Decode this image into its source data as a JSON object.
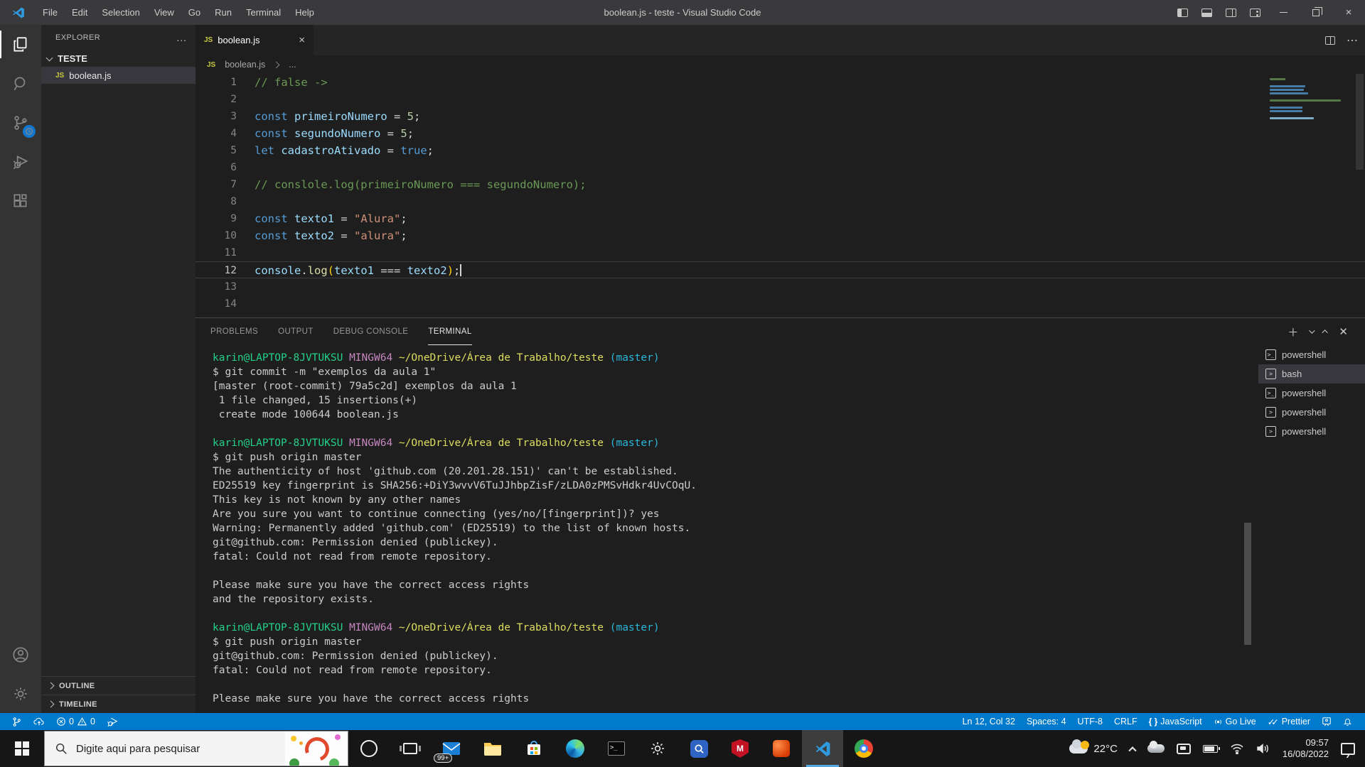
{
  "window": {
    "title": "boolean.js - teste - Visual Studio Code"
  },
  "menu_bar": {
    "items": [
      "File",
      "Edit",
      "Selection",
      "View",
      "Go",
      "Run",
      "Terminal",
      "Help"
    ]
  },
  "sidebar": {
    "header": "EXPLORER",
    "more": "...",
    "section": "TESTE",
    "files": [
      {
        "name": "boolean.js",
        "selected": true
      }
    ],
    "outline": "OUTLINE",
    "timeline": "TIMELINE"
  },
  "editor": {
    "tab": {
      "label": "boolean.js",
      "close": "×"
    },
    "breadcrumb": {
      "file": "boolean.js",
      "more": "..."
    },
    "cursor": {
      "line": 12,
      "col": 32
    },
    "lines": [
      {
        "n": 1,
        "tokens": [
          [
            "cmt",
            "// false ->"
          ]
        ]
      },
      {
        "n": 2,
        "tokens": []
      },
      {
        "n": 3,
        "tokens": [
          [
            "kw",
            "const"
          ],
          [
            "pl",
            " "
          ],
          [
            "var",
            "primeiroNumero"
          ],
          [
            "op",
            " = "
          ],
          [
            "num",
            "5"
          ],
          [
            "pl",
            ";"
          ]
        ]
      },
      {
        "n": 4,
        "tokens": [
          [
            "kw",
            "const"
          ],
          [
            "pl",
            " "
          ],
          [
            "var",
            "segundoNumero"
          ],
          [
            "op",
            " = "
          ],
          [
            "num",
            "5"
          ],
          [
            "pl",
            ";"
          ]
        ]
      },
      {
        "n": 5,
        "tokens": [
          [
            "kw",
            "let"
          ],
          [
            "pl",
            " "
          ],
          [
            "var",
            "cadastroAtivado"
          ],
          [
            "op",
            " = "
          ],
          [
            "kw",
            "true"
          ],
          [
            "pl",
            ";"
          ]
        ]
      },
      {
        "n": 6,
        "tokens": []
      },
      {
        "n": 7,
        "tokens": [
          [
            "cmt",
            "// conslole.log(primeiroNumero === segundoNumero);"
          ]
        ]
      },
      {
        "n": 8,
        "tokens": []
      },
      {
        "n": 9,
        "tokens": [
          [
            "kw",
            "const"
          ],
          [
            "pl",
            " "
          ],
          [
            "var",
            "texto1"
          ],
          [
            "op",
            " = "
          ],
          [
            "str",
            "\"Alura\""
          ],
          [
            "pl",
            ";"
          ]
        ]
      },
      {
        "n": 10,
        "tokens": [
          [
            "kw",
            "const"
          ],
          [
            "pl",
            " "
          ],
          [
            "var",
            "texto2"
          ],
          [
            "op",
            " = "
          ],
          [
            "str",
            "\"alura\""
          ],
          [
            "pl",
            ";"
          ]
        ]
      },
      {
        "n": 11,
        "tokens": []
      },
      {
        "n": 12,
        "current": true,
        "tokens": [
          [
            "var",
            "console"
          ],
          [
            "pl",
            "."
          ],
          [
            "fn",
            "log"
          ],
          [
            "par",
            "("
          ],
          [
            "var",
            "texto1"
          ],
          [
            "op",
            " === "
          ],
          [
            "var",
            "texto2"
          ],
          [
            "par",
            ")"
          ],
          [
            "pl",
            ";"
          ]
        ]
      },
      {
        "n": 13,
        "tokens": []
      },
      {
        "n": 14,
        "tokens": []
      }
    ]
  },
  "panel": {
    "tabs": [
      {
        "label": "PROBLEMS"
      },
      {
        "label": "OUTPUT"
      },
      {
        "label": "DEBUG CONSOLE"
      },
      {
        "label": "TERMINAL",
        "active": true
      }
    ],
    "terminal_lines": [
      [
        [
          "g",
          "karin@LAPTOP-8JVTUKSU"
        ],
        [
          "d",
          " "
        ],
        [
          "m",
          "MINGW64"
        ],
        [
          "d",
          " "
        ],
        [
          "y",
          "~/OneDrive/Área de Trabalho/teste"
        ],
        [
          "d",
          " "
        ],
        [
          "c",
          "(master)"
        ]
      ],
      [
        [
          "d",
          "$ git commit -m \"exemplos da aula 1\""
        ]
      ],
      [
        [
          "d",
          "[master (root-commit) 79a5c2d] exemplos da aula 1"
        ]
      ],
      [
        [
          "d",
          " 1 file changed, 15 insertions(+)"
        ]
      ],
      [
        [
          "d",
          " create mode 100644 boolean.js"
        ]
      ],
      [],
      [
        [
          "g",
          "karin@LAPTOP-8JVTUKSU"
        ],
        [
          "d",
          " "
        ],
        [
          "m",
          "MINGW64"
        ],
        [
          "d",
          " "
        ],
        [
          "y",
          "~/OneDrive/Área de Trabalho/teste"
        ],
        [
          "d",
          " "
        ],
        [
          "c",
          "(master)"
        ]
      ],
      [
        [
          "d",
          "$ git push origin master"
        ]
      ],
      [
        [
          "d",
          "The authenticity of host 'github.com (20.201.28.151)' can't be established."
        ]
      ],
      [
        [
          "d",
          "ED25519 key fingerprint is SHA256:+DiY3wvvV6TuJJhbpZisF/zLDA0zPMSvHdkr4UvCOqU."
        ]
      ],
      [
        [
          "d",
          "This key is not known by any other names"
        ]
      ],
      [
        [
          "d",
          "Are you sure you want to continue connecting (yes/no/[fingerprint])? yes"
        ]
      ],
      [
        [
          "d",
          "Warning: Permanently added 'github.com' (ED25519) to the list of known hosts."
        ]
      ],
      [
        [
          "d",
          "git@github.com: Permission denied (publickey)."
        ]
      ],
      [
        [
          "d",
          "fatal: Could not read from remote repository."
        ]
      ],
      [],
      [
        [
          "d",
          "Please make sure you have the correct access rights"
        ]
      ],
      [
        [
          "d",
          "and the repository exists."
        ]
      ],
      [],
      [
        [
          "g",
          "karin@LAPTOP-8JVTUKSU"
        ],
        [
          "d",
          " "
        ],
        [
          "m",
          "MINGW64"
        ],
        [
          "d",
          " "
        ],
        [
          "y",
          "~/OneDrive/Área de Trabalho/teste"
        ],
        [
          "d",
          " "
        ],
        [
          "c",
          "(master)"
        ]
      ],
      [
        [
          "d",
          "$ git push origin master"
        ]
      ],
      [
        [
          "d",
          "git@github.com: Permission denied (publickey)."
        ]
      ],
      [
        [
          "d",
          "fatal: Could not read from remote repository."
        ]
      ],
      [],
      [
        [
          "d",
          "Please make sure you have the correct access rights"
        ]
      ]
    ],
    "terminal_list": [
      {
        "label": "powershell",
        "icon": "ps"
      },
      {
        "label": "bash",
        "icon": "box",
        "selected": true
      },
      {
        "label": "powershell",
        "icon": "ps"
      },
      {
        "label": "powershell",
        "icon": "box"
      },
      {
        "label": "powershell",
        "icon": "box"
      }
    ]
  },
  "status_bar": {
    "errors": "0",
    "warnings": "0",
    "right_items": [
      {
        "name": "cursor-position",
        "label": "Ln 12, Col 32"
      },
      {
        "name": "indentation",
        "label": "Spaces: 4"
      },
      {
        "name": "encoding",
        "label": "UTF-8"
      },
      {
        "name": "eol",
        "label": "CRLF"
      },
      {
        "name": "language-mode",
        "label": "JavaScript",
        "icon": "braces"
      },
      {
        "name": "go-live",
        "label": "Go Live",
        "icon": "broadcast"
      },
      {
        "name": "prettier",
        "label": "Prettier",
        "icon": "double-check"
      },
      {
        "name": "feedback",
        "label": "",
        "icon": "person"
      },
      {
        "name": "notifications",
        "label": "",
        "icon": "bell"
      }
    ]
  },
  "taskbar": {
    "search_placeholder": "Digite aqui para pesquisar",
    "mail_badge": "99+",
    "tray": {
      "temperature": "22°C",
      "time": "09:57",
      "date": "16/08/2022"
    }
  },
  "colors": {
    "status_bar_bg": "#007acc",
    "title_bar_bg": "#3a3a3d",
    "editor_bg": "#1e1e1e",
    "sidebar_bg": "#252526",
    "activity_bar_bg": "#333333",
    "scm_badge": "#1177d1",
    "taskbar_bg": "#161616",
    "selection_row": "#37373d"
  }
}
